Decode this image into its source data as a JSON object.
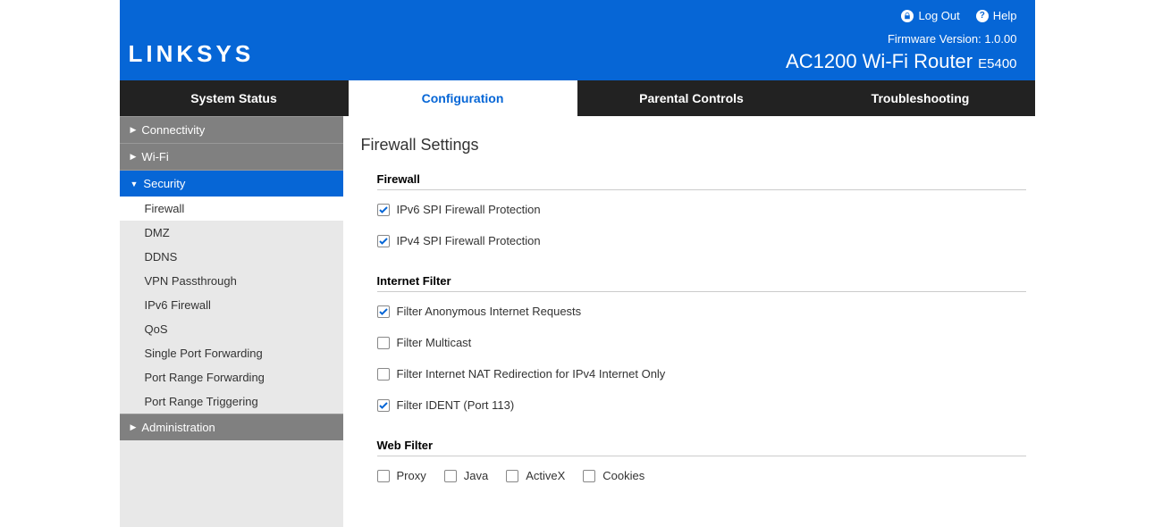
{
  "header": {
    "logout": "Log Out",
    "help": "Help",
    "firmware_label": "Firmware Version:",
    "firmware_value": "1.0.00",
    "product": "AC1200 Wi-Fi Router",
    "model": "E5400",
    "logo": "LINKSYS"
  },
  "tabs": [
    {
      "label": "System Status",
      "active": false
    },
    {
      "label": "Configuration",
      "active": true
    },
    {
      "label": "Parental Controls",
      "active": false
    },
    {
      "label": "Troubleshooting",
      "active": false
    }
  ],
  "sidebar": {
    "categories": [
      {
        "label": "Connectivity",
        "expanded": false
      },
      {
        "label": "Wi-Fi",
        "expanded": false
      },
      {
        "label": "Security",
        "expanded": true,
        "items": [
          {
            "label": "Firewall",
            "active": true
          },
          {
            "label": "DMZ",
            "active": false
          },
          {
            "label": "DDNS",
            "active": false
          },
          {
            "label": "VPN Passthrough",
            "active": false
          },
          {
            "label": "IPv6 Firewall",
            "active": false
          },
          {
            "label": "QoS",
            "active": false
          },
          {
            "label": "Single Port Forwarding",
            "active": false
          },
          {
            "label": "Port Range Forwarding",
            "active": false
          },
          {
            "label": "Port Range Triggering",
            "active": false
          }
        ]
      },
      {
        "label": "Administration",
        "expanded": false
      }
    ]
  },
  "page": {
    "title": "Firewall Settings",
    "sections": {
      "firewall": {
        "title": "Firewall",
        "items": [
          {
            "label": "IPv6 SPI Firewall Protection",
            "checked": true
          },
          {
            "label": "IPv4 SPI Firewall Protection",
            "checked": true
          }
        ]
      },
      "internet_filter": {
        "title": "Internet Filter",
        "items": [
          {
            "label": "Filter Anonymous Internet Requests",
            "checked": true
          },
          {
            "label": "Filter Multicast",
            "checked": false
          },
          {
            "label": "Filter Internet NAT Redirection for IPv4 Internet Only",
            "checked": false
          },
          {
            "label": "Filter IDENT (Port 113)",
            "checked": true
          }
        ]
      },
      "web_filter": {
        "title": "Web Filter",
        "items": [
          {
            "label": "Proxy",
            "checked": false
          },
          {
            "label": "Java",
            "checked": false
          },
          {
            "label": "ActiveX",
            "checked": false
          },
          {
            "label": "Cookies",
            "checked": false
          }
        ]
      }
    }
  }
}
